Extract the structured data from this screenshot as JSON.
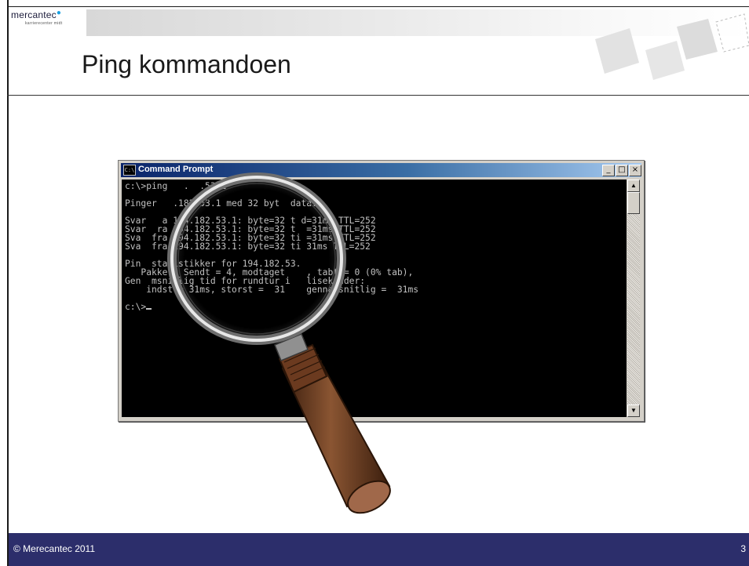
{
  "logo": {
    "name": "mercantec",
    "subtitle": "karrierecenter midt"
  },
  "slide": {
    "title": "Ping kommandoen"
  },
  "window": {
    "title": "Command Prompt",
    "icon_text": "C:\\",
    "controls": {
      "minimize": "_",
      "maximize": "□",
      "close": "×"
    },
    "scroll_up": "▲",
    "scroll_down": "▼",
    "lines": [
      "c:\\>ping   .  .53.1",
      "",
      "Pinger   .182.53.1 med 32 byt  data:",
      "",
      "Svar   a 194.182.53.1: byte=32 t d=31ms TTL=252",
      "Svar  ra 194.182.53.1: byte=32 t  =31ms TTL=252",
      "Sva  fra 194.182.53.1: byte=32 ti =31ms TTL=252",
      "Sva  fra 194.182.53.1: byte=32 ti 31ms TTL=252",
      "",
      "Pin  statistikker for 194.182.53.",
      "   Pakker: Sendt = 4, modtaget    , tabt = 0 (0% tab),",
      "Gen  msnitlig tid for rundtur i   lisekunder:",
      "    indst = 31ms, storst =  31    gennemsnitlig =  31ms",
      "",
      "c:\\>"
    ]
  },
  "footer": {
    "copyright": "© Merecantec 2011",
    "page_number": "3"
  },
  "colors": {
    "footer_bg": "#2c2e6b",
    "titlebar_start": "#0a246a",
    "titlebar_end": "#a6caf0",
    "console_bg": "#000000",
    "console_text": "#c0c0c0",
    "handle": "#6b3a1f"
  },
  "icons": [
    "console-app-icon",
    "magnifying-glass-illustration",
    "decorative-cards"
  ]
}
